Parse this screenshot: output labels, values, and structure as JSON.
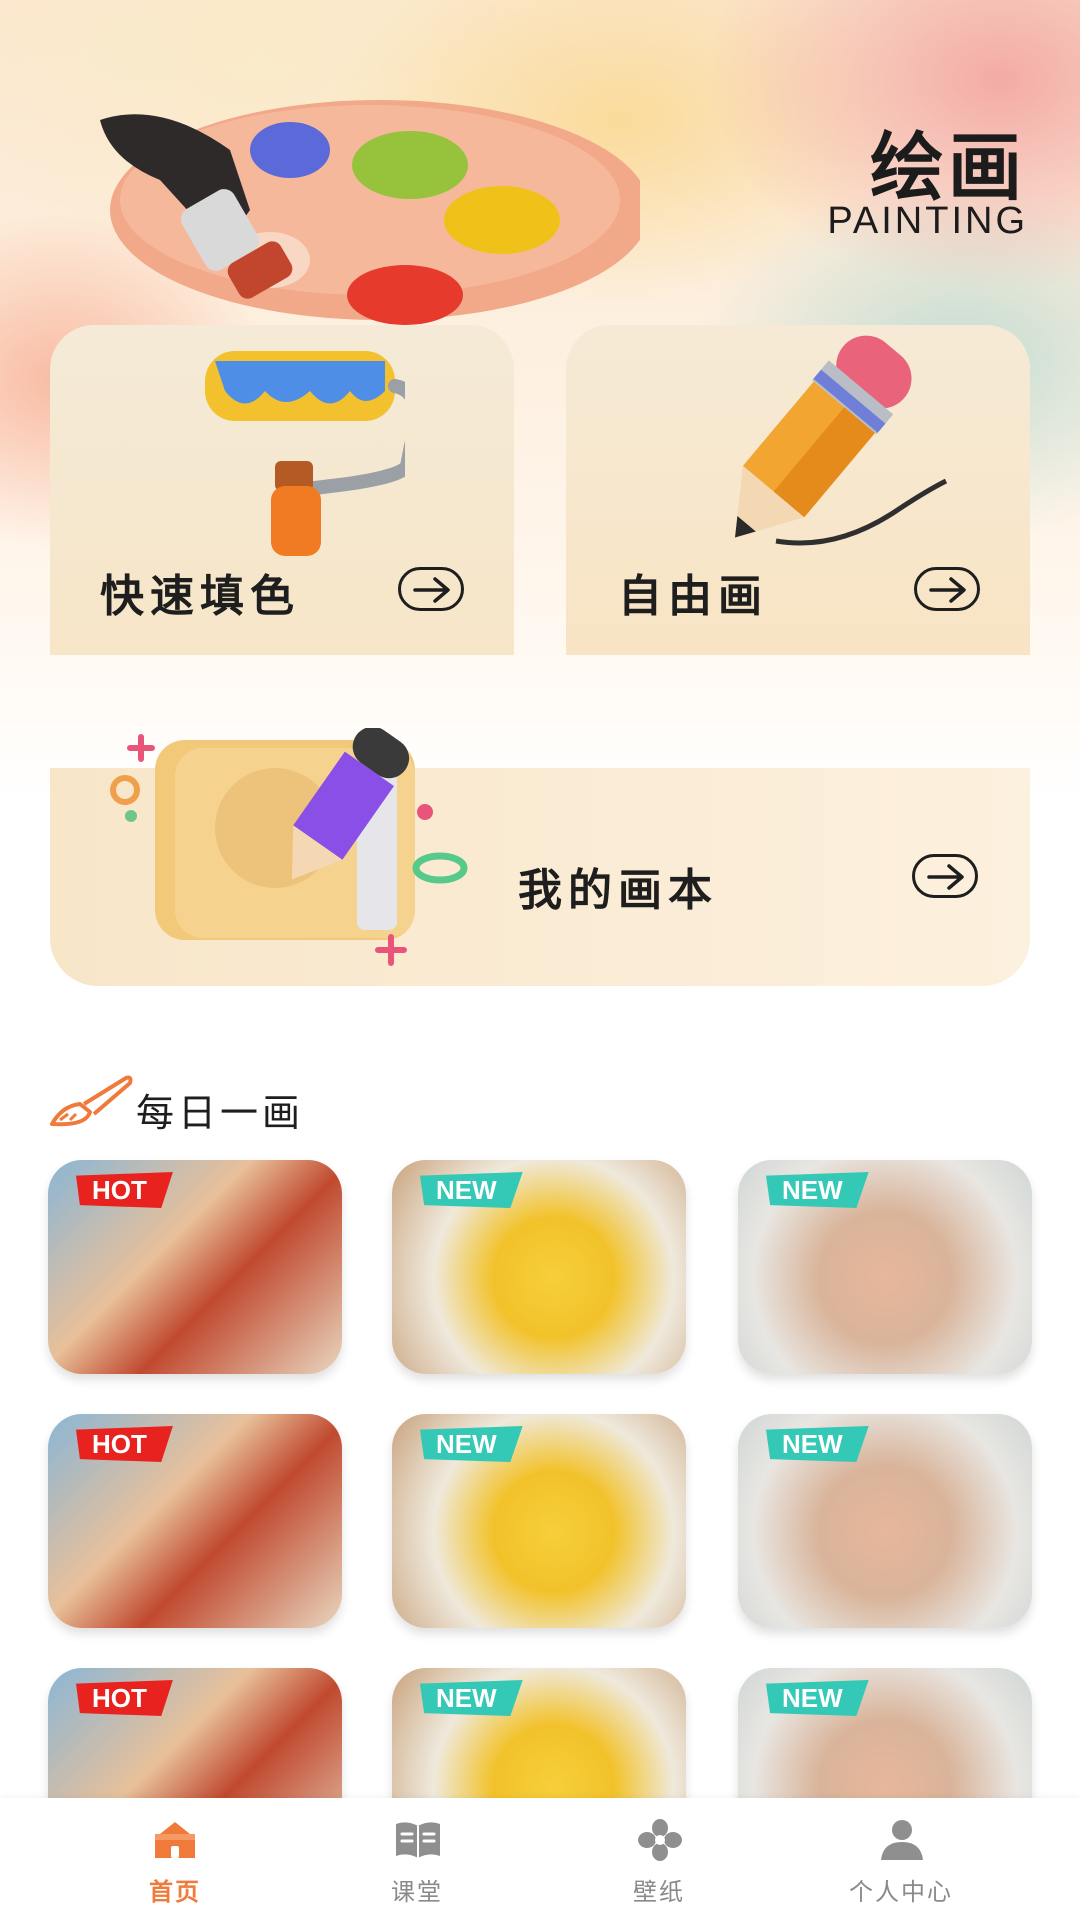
{
  "header": {
    "title_cn": "绘画",
    "title_en": "PAINTING"
  },
  "cards": {
    "quick_fill": {
      "label": "快速填色",
      "icon": "paint-roller-icon"
    },
    "free_draw": {
      "label": "自由画",
      "icon": "pencil-icon"
    },
    "my_sketchbook": {
      "label": "我的画本",
      "icon": "sketchbook-icon"
    }
  },
  "daily": {
    "title": "每日一画",
    "icon": "brush-icon",
    "badges": {
      "hot": "HOT",
      "new": "NEW"
    }
  },
  "tabs": [
    {
      "label": "首页",
      "icon": "home-icon",
      "active": true
    },
    {
      "label": "课堂",
      "icon": "book-icon",
      "active": false
    },
    {
      "label": "壁纸",
      "icon": "clover-icon",
      "active": false
    },
    {
      "label": "个人中心",
      "icon": "user-icon",
      "active": false
    }
  ],
  "colors": {
    "accent": "#f07a3a",
    "hot": "#e8231f",
    "new": "#34c8b6"
  }
}
